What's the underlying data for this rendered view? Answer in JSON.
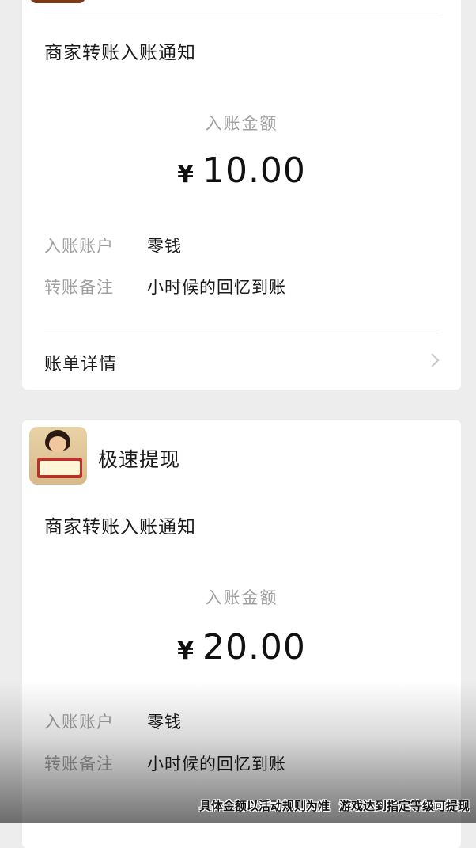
{
  "cards": [
    {
      "notice_title": "商家转账入账通知",
      "amount_label": "入账金额",
      "currency": "¥",
      "amount": "10.00",
      "rows": [
        {
          "label": "入账账户",
          "value": "零钱"
        },
        {
          "label": "转账备注",
          "value": "小时候的回忆到账"
        }
      ],
      "detail_label": "账单详情"
    },
    {
      "app_name": "极速提现",
      "notice_title": "商家转账入账通知",
      "amount_label": "入账金额",
      "currency": "¥",
      "amount": "20.00",
      "rows": [
        {
          "label": "入账账户",
          "value": "零钱"
        },
        {
          "label": "转账备注",
          "value": "小时候的回忆到账"
        }
      ]
    }
  ],
  "caption": {
    "left": "具体金额以活动规则为准",
    "right": "游戏达到指定等级可提现"
  }
}
